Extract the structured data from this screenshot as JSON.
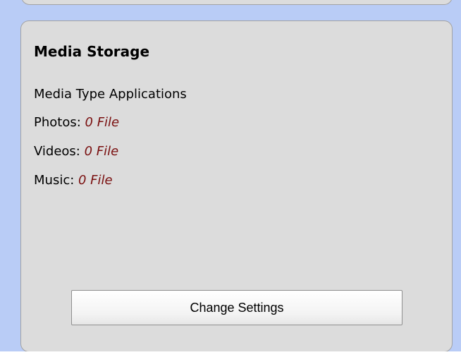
{
  "panel": {
    "title": "Media Storage",
    "subtitle": "Media Type Applications",
    "items": [
      {
        "label": "Photos: ",
        "count": "0 File"
      },
      {
        "label": "Videos: ",
        "count": "0 File"
      },
      {
        "label": "Music: ",
        "count": "0 File"
      }
    ],
    "button_label": "Change Settings"
  },
  "colors": {
    "background": "#b9ccf6",
    "panel": "#dcdcdc",
    "count_text": "#7a1010"
  }
}
